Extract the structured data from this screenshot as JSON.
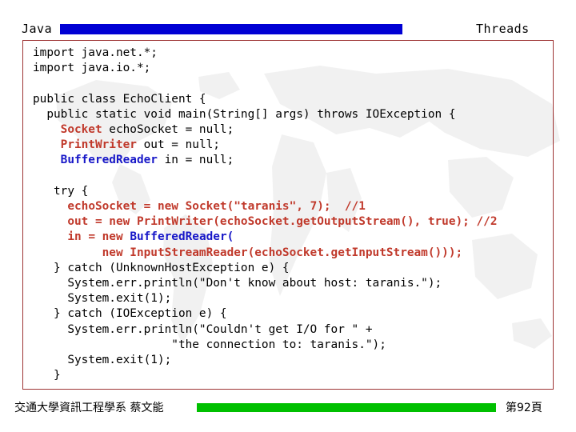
{
  "header": {
    "title": "Java",
    "topic": "Threads",
    "bar_color": "#0000d4"
  },
  "code": {
    "language": "java",
    "border_color": "#9e3333",
    "colors": {
      "plain": "#000000",
      "red": "#c0392b",
      "blue": "#1818c8"
    },
    "lines": [
      [
        {
          "t": "import java.net.*;",
          "c": "plain"
        }
      ],
      [
        {
          "t": "import java.io.*;",
          "c": "plain"
        }
      ],
      [
        {
          "t": "",
          "c": "plain"
        }
      ],
      [
        {
          "t": "public class EchoClient {",
          "c": "plain"
        }
      ],
      [
        {
          "t": "  public static void main(String[] args) throws IOException {",
          "c": "plain"
        }
      ],
      [
        {
          "t": "    ",
          "c": "plain"
        },
        {
          "t": "Socket",
          "c": "red"
        },
        {
          "t": " echoSocket = null;",
          "c": "plain"
        }
      ],
      [
        {
          "t": "    ",
          "c": "plain"
        },
        {
          "t": "PrintWriter",
          "c": "red"
        },
        {
          "t": " out = null;",
          "c": "plain"
        }
      ],
      [
        {
          "t": "    ",
          "c": "plain"
        },
        {
          "t": "BufferedReader",
          "c": "blue"
        },
        {
          "t": " in = null;",
          "c": "plain"
        }
      ],
      [
        {
          "t": "",
          "c": "plain"
        }
      ],
      [
        {
          "t": "   try {",
          "c": "plain"
        }
      ],
      [
        {
          "t": "     ",
          "c": "plain"
        },
        {
          "t": "echoSocket = new Socket(\"taranis\", 7);  //1",
          "c": "red"
        }
      ],
      [
        {
          "t": "     ",
          "c": "plain"
        },
        {
          "t": "out = new PrintWriter(echoSocket.getOutputStream(), true); //2",
          "c": "red"
        }
      ],
      [
        {
          "t": "     ",
          "c": "plain"
        },
        {
          "t": "in = new ",
          "c": "red"
        },
        {
          "t": "BufferedReader(",
          "c": "blue"
        }
      ],
      [
        {
          "t": "          ",
          "c": "plain"
        },
        {
          "t": "new InputStreamReader(echoSocket.getInputStream()));",
          "c": "red"
        }
      ],
      [
        {
          "t": "   } catch (UnknownHostException e) {",
          "c": "plain"
        }
      ],
      [
        {
          "t": "     System.err.println(\"Don't know about host: taranis.\");",
          "c": "plain"
        }
      ],
      [
        {
          "t": "     System.exit(1);",
          "c": "plain"
        }
      ],
      [
        {
          "t": "   } catch (IOException e) {",
          "c": "plain"
        }
      ],
      [
        {
          "t": "     System.err.println(\"Couldn't get I/O for \" +",
          "c": "plain"
        }
      ],
      [
        {
          "t": "                    \"the connection to: taranis.\");",
          "c": "plain"
        }
      ],
      [
        {
          "t": "     System.exit(1);",
          "c": "plain"
        }
      ],
      [
        {
          "t": "   }",
          "c": "plain"
        }
      ]
    ]
  },
  "footer": {
    "organization": "交通大學資訊工程學系 蔡文能",
    "page_label": "第92頁",
    "bar_color": "#00c000"
  }
}
